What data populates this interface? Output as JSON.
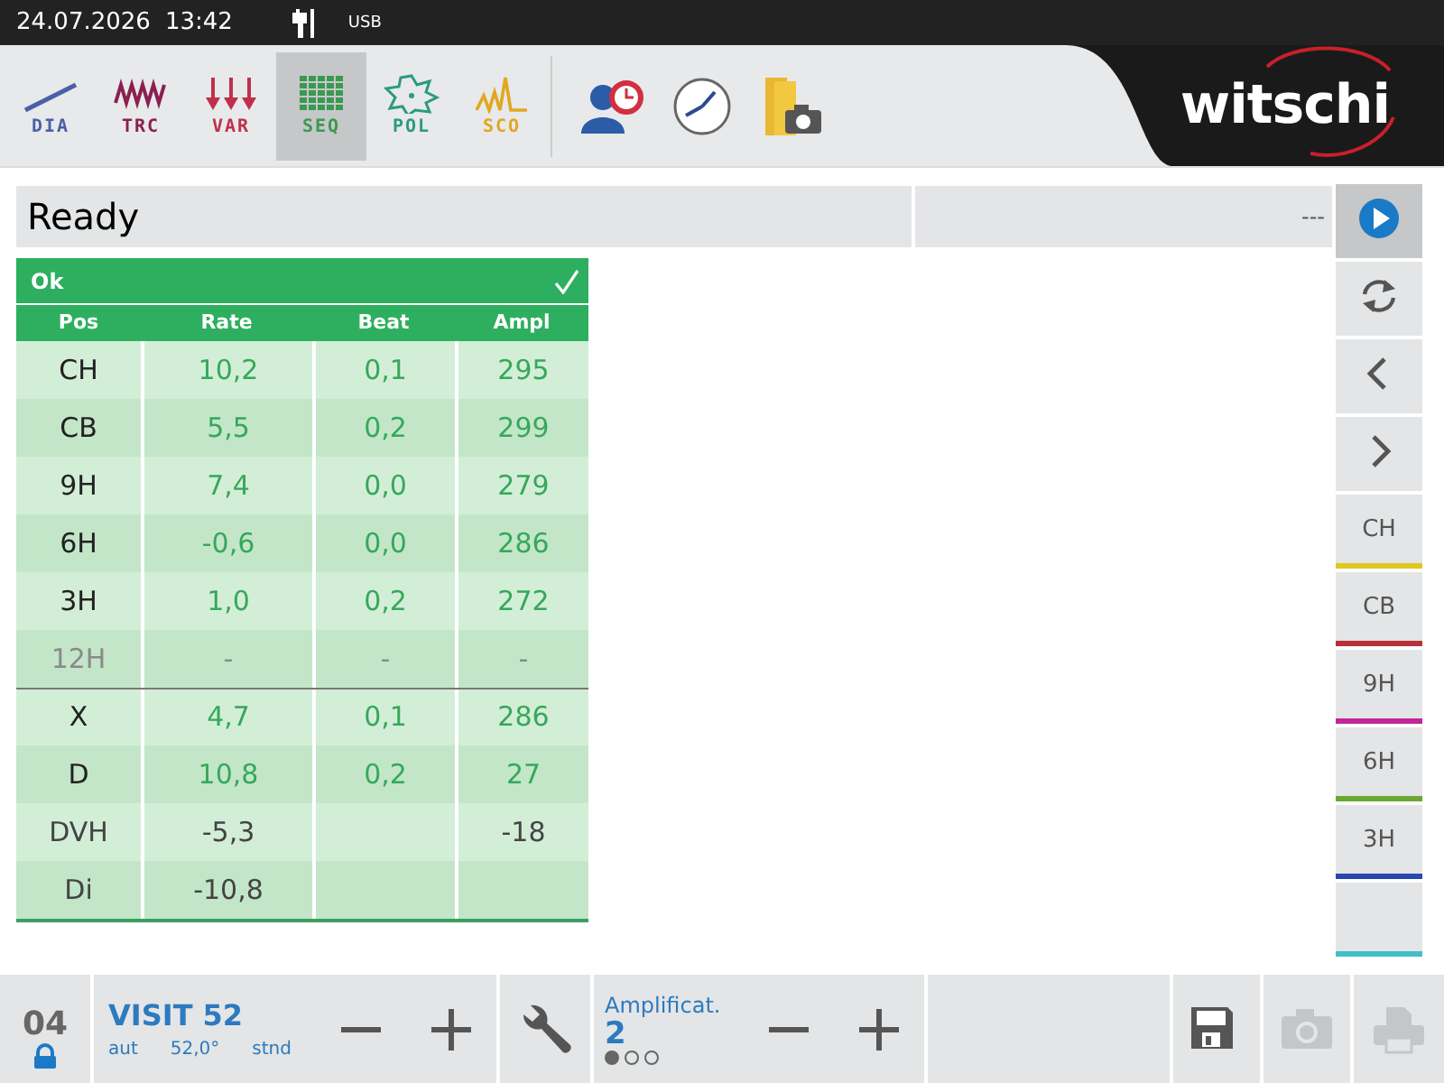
{
  "status_bar": {
    "date": "24.07.2026",
    "time": "13:42",
    "usb": "USB"
  },
  "toolbar": {
    "tools": [
      {
        "label": "DIA",
        "kind": "dia",
        "color": "#4a5fa8",
        "selected": false
      },
      {
        "label": "TRC",
        "kind": "trc",
        "color": "#8a2050",
        "selected": false
      },
      {
        "label": "VAR",
        "kind": "var",
        "color": "#c0304a",
        "selected": false
      },
      {
        "label": "SEQ",
        "kind": "seq",
        "color": "#3a9a50",
        "selected": true
      },
      {
        "label": "POL",
        "kind": "pol",
        "color": "#2a9a80",
        "selected": false
      },
      {
        "label": "SCO",
        "kind": "sco",
        "color": "#e0a820",
        "selected": false
      }
    ],
    "logo": "witschi"
  },
  "status": {
    "message": "Ready",
    "value": "---"
  },
  "table": {
    "title": "Ok",
    "passed": true,
    "columns": [
      "Pos",
      "Rate",
      "Beat",
      "Ampl"
    ],
    "rows": [
      {
        "kind": "measured",
        "cells": [
          "CH",
          "10,2",
          "0,1",
          "295"
        ]
      },
      {
        "kind": "measured",
        "cells": [
          "CB",
          "5,5",
          "0,2",
          "299"
        ]
      },
      {
        "kind": "measured",
        "cells": [
          "9H",
          "7,4",
          "0,0",
          "279"
        ]
      },
      {
        "kind": "measured",
        "cells": [
          "6H",
          "-0,6",
          "0,0",
          "286"
        ]
      },
      {
        "kind": "measured",
        "cells": [
          "3H",
          "1,0",
          "0,2",
          "272"
        ]
      },
      {
        "kind": "inactive",
        "cells": [
          "12H",
          "-",
          "-",
          "-"
        ]
      }
    ],
    "summary": [
      {
        "kind": "measured",
        "cells": [
          "X",
          "4,7",
          "0,1",
          "286"
        ]
      },
      {
        "kind": "measured",
        "cells": [
          "D",
          "10,8",
          "0,2",
          "27"
        ]
      },
      {
        "kind": "derived",
        "cells": [
          "DVH",
          "-5,3",
          "",
          "-18"
        ]
      },
      {
        "kind": "derived",
        "cells": [
          "Di",
          "-10,8",
          "",
          ""
        ]
      }
    ]
  },
  "side_panel": {
    "buttons": [
      {
        "kind": "play",
        "selected": true
      },
      {
        "kind": "refresh",
        "selected": false
      },
      {
        "kind": "prev",
        "selected": false
      },
      {
        "kind": "next",
        "selected": false
      }
    ],
    "positions": [
      {
        "label": "CH",
        "color": "#e0c820"
      },
      {
        "label": "CB",
        "color": "#b8303a"
      },
      {
        "label": "9H",
        "color": "#c0289a"
      },
      {
        "label": "6H",
        "color": "#6aa830"
      },
      {
        "label": "3H",
        "color": "#2848b0"
      },
      {
        "color": "#40c0c8"
      }
    ]
  },
  "bottom_bar": {
    "slot": "04",
    "locked": true,
    "program": {
      "name": "VISIT 52",
      "mode": "aut",
      "lift_angle": "52,0°",
      "standard": "stnd"
    },
    "amplification": {
      "label": "Amplificat.",
      "value": "2",
      "dots": [
        {
          "selected": true
        },
        {
          "selected": false
        },
        {
          "selected": false
        }
      ]
    },
    "actions": [
      {
        "kind": "save",
        "disabled": false
      },
      {
        "kind": "camera",
        "disabled": true
      },
      {
        "kind": "print",
        "disabled": true
      }
    ]
  }
}
